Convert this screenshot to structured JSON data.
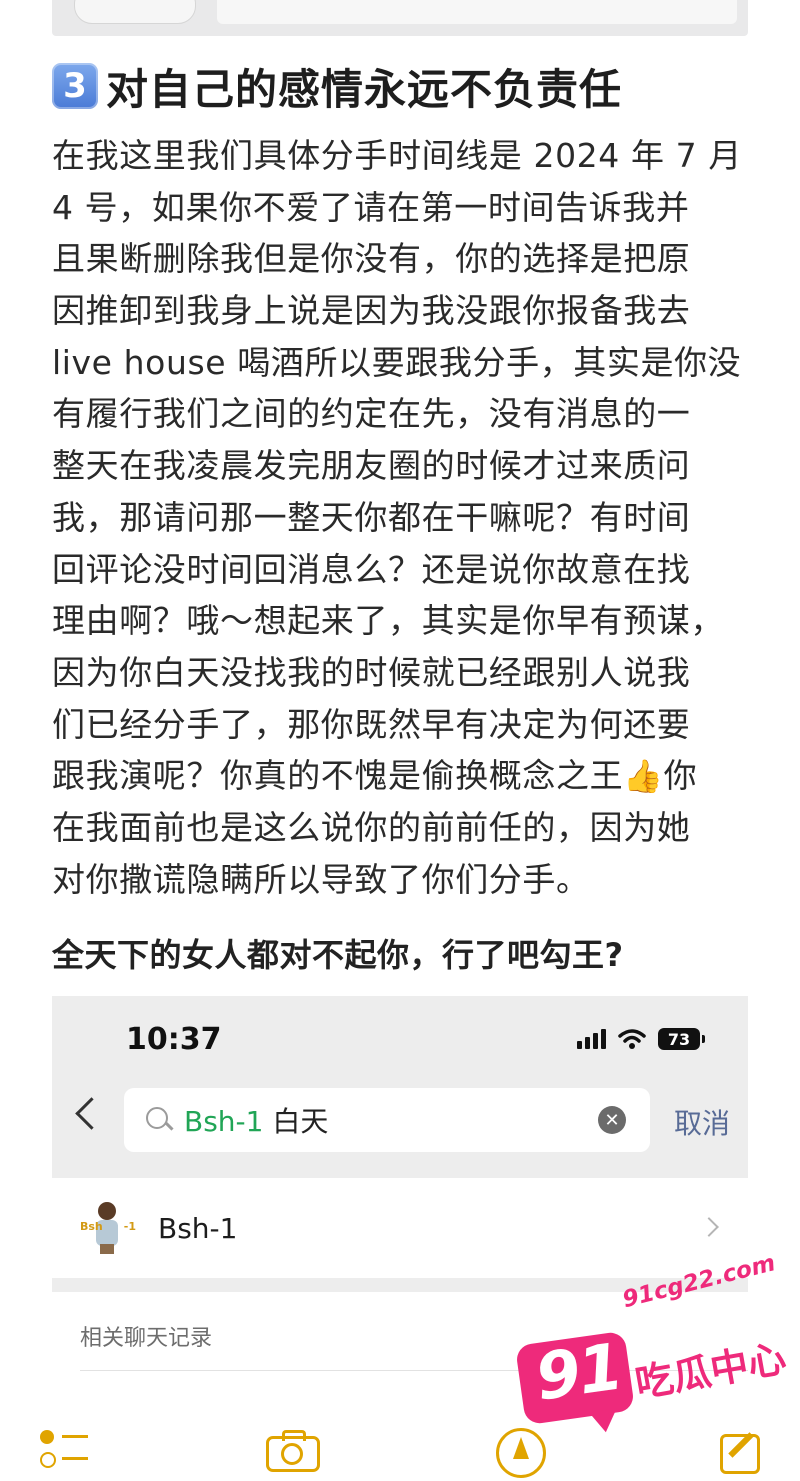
{
  "heading": {
    "badge": "3",
    "title": "对自己的感情永远不负责任"
  },
  "body": {
    "lines": [
      "在我这里我们具体分手时间线是 2024 年 7 月",
      "4 号，如果你不爱了请在第一时间告诉我并",
      "且果断删除我但是你没有，你的选择是把原",
      "因推卸到我身上说是因为我没跟你报备我去",
      "live house 喝酒所以要跟我分手，其实是你没",
      "有履行我们之间的约定在先，没有消息的一",
      "整天在我凌晨发完朋友圈的时候才过来质问",
      "我，那请问那一整天你都在干嘛呢？有时间",
      "回评论没时间回消息么？还是说你故意在找",
      "理由啊？哦～想起来了，其实是你早有预谋，",
      "因为你白天没找我的时候就已经跟别人说我",
      "们已经分手了，那你既然早有决定为何还要",
      "跟我演呢？你真的不愧是偷换概念之王",
      "在我面前也是这么说你的前前任的，因为她",
      "对你撒谎隐瞒所以导致了你们分手。"
    ],
    "line13_emoji": "👍",
    "line13_tail": "你",
    "bold_line": "全天下的女人都对不起你，行了吧勾王?"
  },
  "screenshot": {
    "status_time": "10:37",
    "battery": "73",
    "search_highlight": "Bsh-1",
    "search_rest": " 白天",
    "cancel_label": "取消",
    "contact_name": "Bsh-1",
    "avatar_tag_left": "Bsh",
    "avatar_tag_right": "-1",
    "section_label": "相关聊天记录"
  },
  "watermark": {
    "site": "91cg22.com",
    "number": "91",
    "name": "吃瓜中心"
  },
  "colors": {
    "accent_yellow": "#e0a400",
    "watermark_pink": "#ee2a7b",
    "search_highlight_green": "#21a556",
    "cancel_blue": "#586b96"
  },
  "toolbar": {
    "icons": [
      "checklist-icon",
      "camera-icon",
      "markup-icon",
      "compose-icon"
    ]
  }
}
